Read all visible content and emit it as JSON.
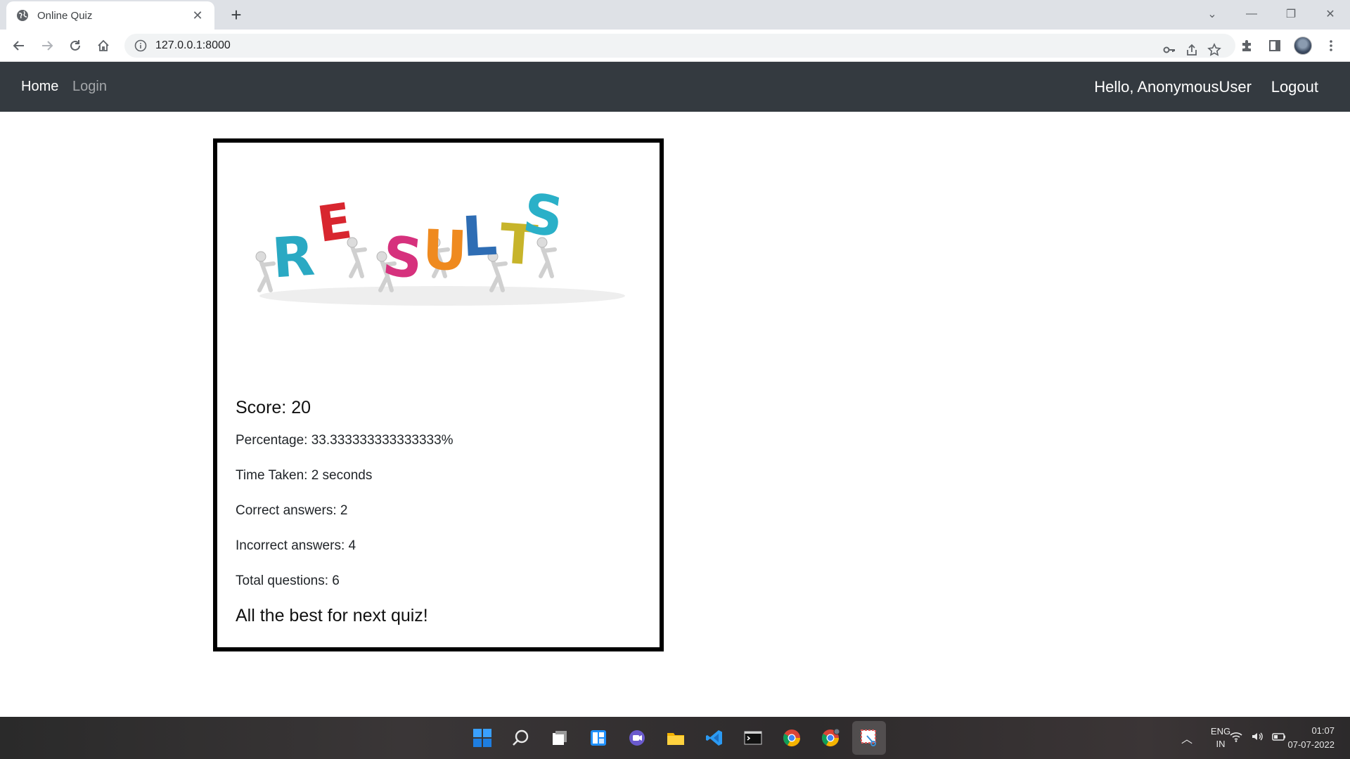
{
  "browser": {
    "tab_title": "Online Quiz",
    "url": "127.0.0.1:8000"
  },
  "nav": {
    "home": "Home",
    "login": "Login",
    "greeting": "Hello, AnonymousUser",
    "logout": "Logout"
  },
  "results": {
    "banner_letters": [
      "R",
      "E",
      "S",
      "U",
      "L",
      "T",
      "S"
    ],
    "banner_colors": [
      "#2aa9c3",
      "#d8262f",
      "#d6317d",
      "#ef8a1f",
      "#2e6db4",
      "#c7b42a",
      "#2ab0c8"
    ],
    "score": "Score: 20",
    "percentage": "Percentage: 33.333333333333333%",
    "time_taken": "Time Taken: 2 seconds",
    "correct": "Correct answers: 2",
    "incorrect": "Incorrect answers: 4",
    "total": "Total questions: 6",
    "message": "All the best for next quiz!"
  },
  "taskbar": {
    "apps": [
      "start-icon",
      "search-icon",
      "task-view-icon",
      "widgets-icon",
      "teams-chat-icon",
      "file-explorer-icon",
      "vscode-icon",
      "terminal-icon",
      "chrome-icon",
      "chrome-profile-icon",
      "snipping-tool-icon"
    ],
    "lang_top": "ENG",
    "lang_bottom": "IN",
    "time": "01:07",
    "date": "07-07-2022"
  }
}
